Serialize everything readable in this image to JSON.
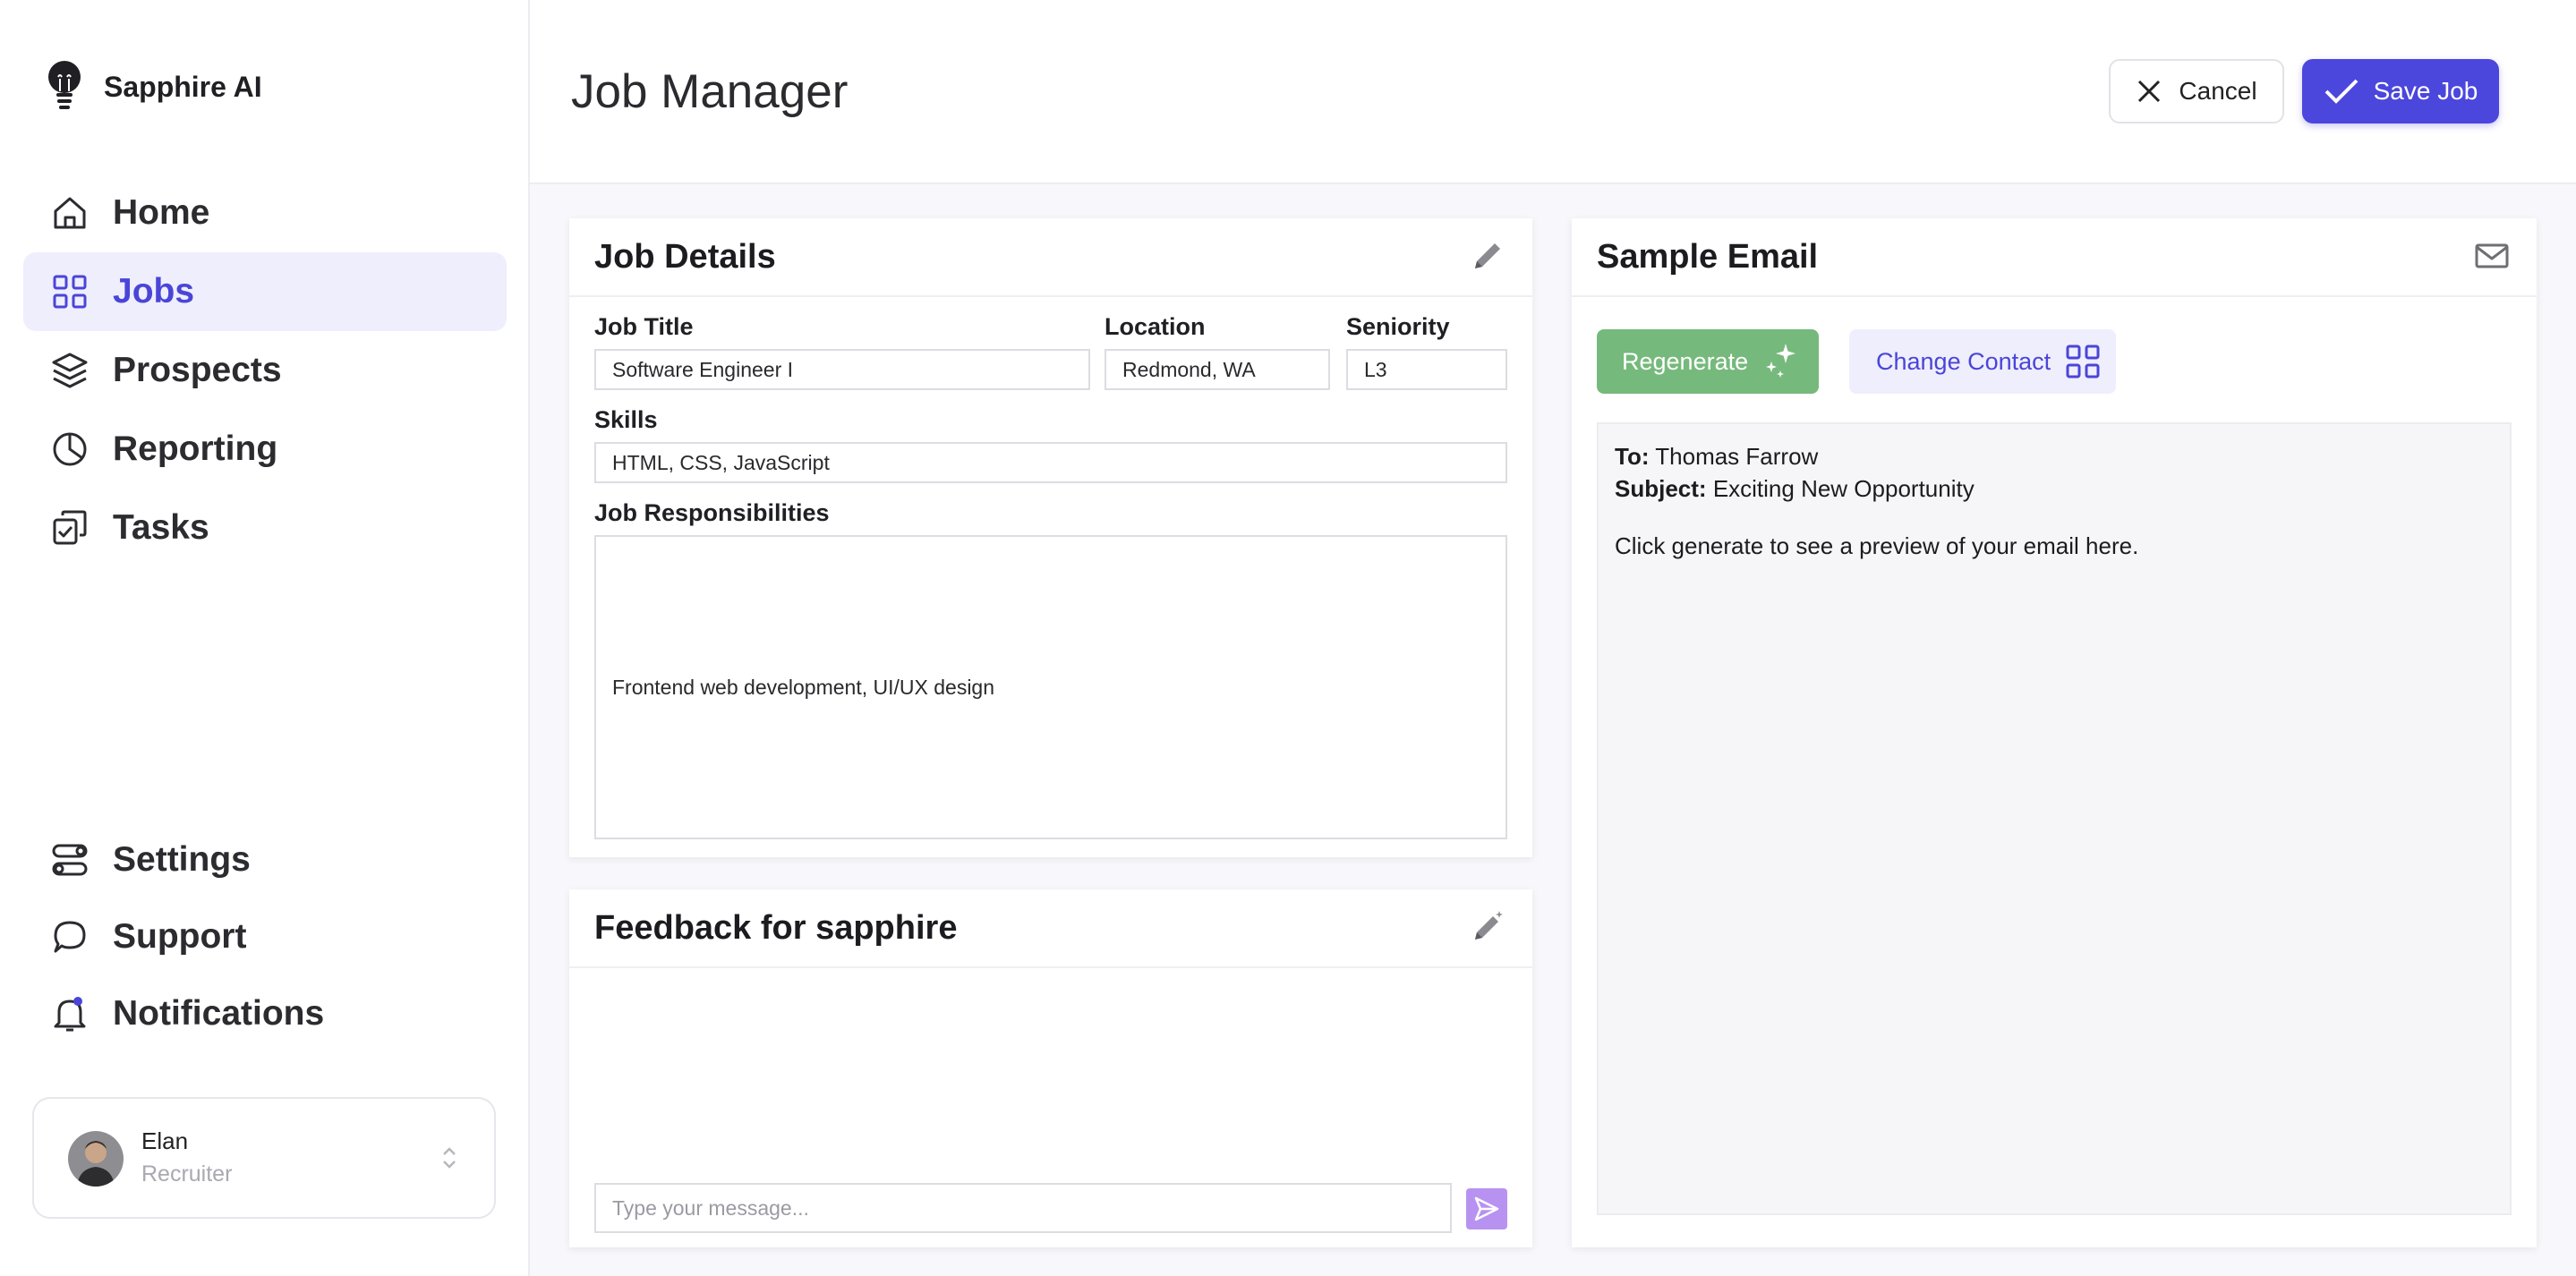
{
  "app": {
    "brand": "Sapphire AI"
  },
  "sidebar": {
    "nav_top": [
      {
        "label": "Home",
        "icon": "home-icon",
        "active": false
      },
      {
        "label": "Jobs",
        "icon": "grid-icon",
        "active": true
      },
      {
        "label": "Prospects",
        "icon": "layers-icon",
        "active": false
      },
      {
        "label": "Reporting",
        "icon": "pie-chart-icon",
        "active": false
      },
      {
        "label": "Tasks",
        "icon": "tasks-icon",
        "active": false
      }
    ],
    "nav_bottom": [
      {
        "label": "Settings",
        "icon": "toggles-icon"
      },
      {
        "label": "Support",
        "icon": "chat-icon"
      },
      {
        "label": "Notifications",
        "icon": "bell-icon"
      }
    ],
    "user": {
      "name": "Elan",
      "role": "Recruiter"
    }
  },
  "header": {
    "title": "Job Manager",
    "cancel_label": "Cancel",
    "save_label": "Save Job"
  },
  "job_details": {
    "title": "Job Details",
    "job_title_label": "Job Title",
    "job_title_value": "Software Engineer I",
    "location_label": "Location",
    "location_value": "Redmond, WA",
    "seniority_label": "Seniority",
    "seniority_value": "L3",
    "skills_label": "Skills",
    "skills_value": "HTML, CSS, JavaScript",
    "responsibilities_label": "Job Responsibilities",
    "responsibilities_value": "Frontend web development, UI/UX design"
  },
  "feedback": {
    "title": "Feedback for sapphire",
    "placeholder": "Type your message..."
  },
  "email": {
    "title": "Sample Email",
    "regenerate_label": "Regenerate",
    "change_contact_label": "Change Contact",
    "to_label": "To:",
    "to_value": "Thomas Farrow",
    "subject_label": "Subject:",
    "subject_value": "Exciting New Opportunity",
    "body": "Click generate to see a preview of your email here."
  },
  "colors": {
    "accent": "#4b46dc",
    "active_bg": "#efeefc",
    "regenerate": "#76b97c",
    "send": "#b892f0"
  }
}
